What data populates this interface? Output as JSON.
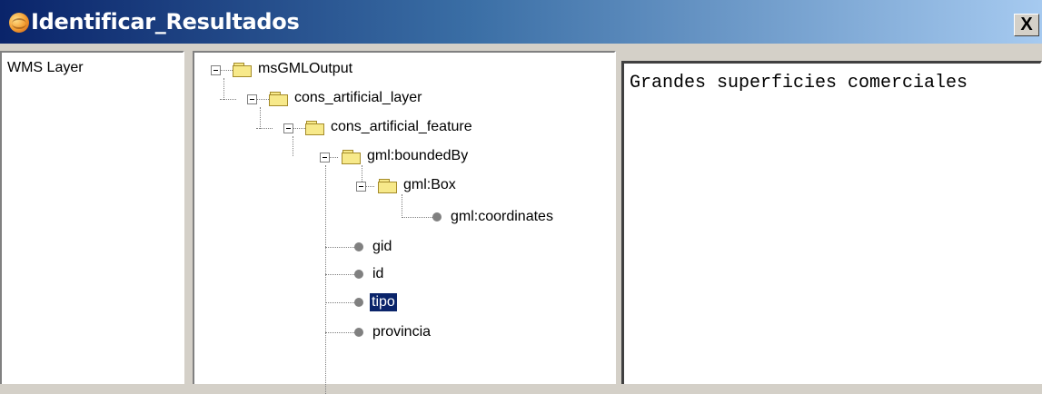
{
  "window": {
    "title": "Identificar_Resultados",
    "close_label": "X",
    "icon": "gvsig-globe-icon"
  },
  "layers": {
    "items": [
      {
        "label": "WMS Layer"
      }
    ]
  },
  "tree": {
    "nodes": [
      {
        "label": "msGMLOutput",
        "type": "folder",
        "expanded": true
      },
      {
        "label": "cons_artificial_layer",
        "type": "folder",
        "expanded": true
      },
      {
        "label": "cons_artificial_feature",
        "type": "folder",
        "expanded": true
      },
      {
        "label": "gml:boundedBy",
        "type": "folder",
        "expanded": true
      },
      {
        "label": "gml:Box",
        "type": "folder",
        "expanded": true
      },
      {
        "label": "gml:coordinates",
        "type": "leaf"
      },
      {
        "label": "gid",
        "type": "leaf"
      },
      {
        "label": "id",
        "type": "leaf"
      },
      {
        "label": "tipo",
        "type": "leaf",
        "selected": true
      },
      {
        "label": "provincia",
        "type": "leaf"
      }
    ]
  },
  "result": {
    "value": "Grandes superficies comerciales"
  }
}
